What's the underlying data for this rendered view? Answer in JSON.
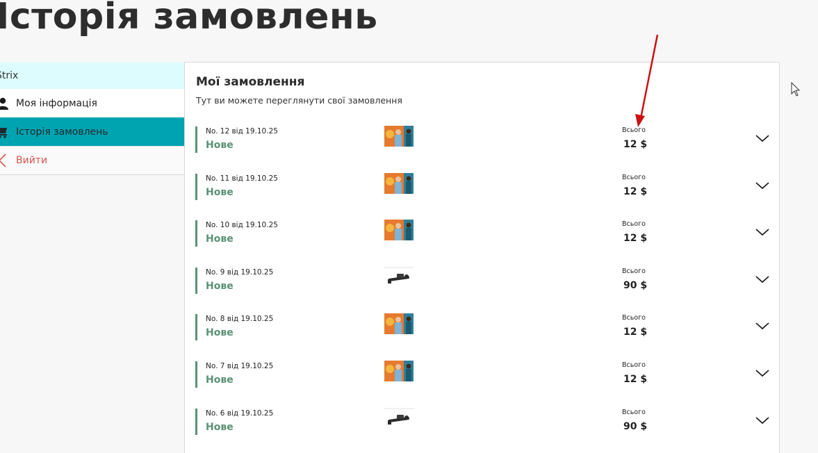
{
  "page": {
    "title": "Історія замовлень"
  },
  "sidebar": {
    "user": "Strix",
    "items": [
      {
        "label": "Моя інформація",
        "icon": "user-icon"
      },
      {
        "label": "Історія замовлень",
        "icon": "cart-icon"
      },
      {
        "label": "Вийти",
        "icon": "logout-chevron-icon"
      }
    ]
  },
  "main": {
    "title": "Мої замовлення",
    "subtitle": "Тут ви можете переглянути свої замовлення",
    "total_label": "Всього",
    "orders": [
      {
        "number": "No. 12 від 19.10.25",
        "status": "Нове",
        "total": "12 $",
        "thumb": "photo"
      },
      {
        "number": "No. 11 від 19.10.25",
        "status": "Нове",
        "total": "12 $",
        "thumb": "photo"
      },
      {
        "number": "No. 10 від 19.10.25",
        "status": "Нове",
        "total": "12 $",
        "thumb": "photo"
      },
      {
        "number": "No. 9 від 19.10.25",
        "status": "Нове",
        "total": "90 $",
        "thumb": "tool"
      },
      {
        "number": "No. 8 від 19.10.25",
        "status": "Нове",
        "total": "12 $",
        "thumb": "photo"
      },
      {
        "number": "No. 7 від 19.10.25",
        "status": "Нове",
        "total": "12 $",
        "thumb": "photo"
      },
      {
        "number": "No. 6 від 19.10.25",
        "status": "Нове",
        "total": "90 $",
        "thumb": "tool"
      }
    ]
  },
  "colors": {
    "accent": "#00a3b0",
    "status": "#5a9275",
    "logout": "#d9534f",
    "annotation_arrow": "#cc1111"
  }
}
